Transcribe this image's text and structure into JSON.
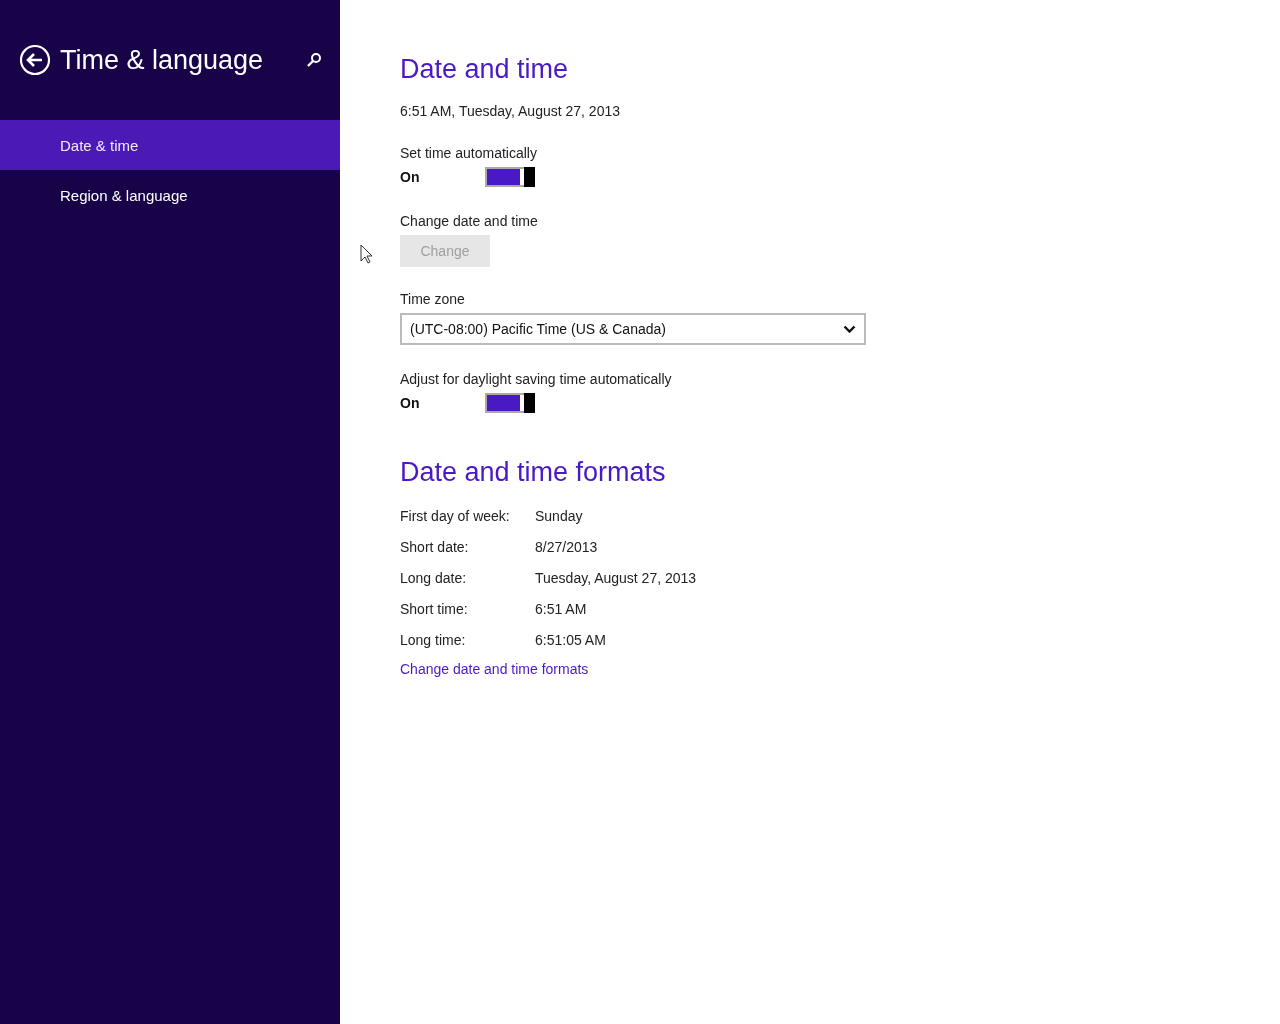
{
  "sidebar": {
    "title": "Time & language",
    "items": [
      {
        "label": "Date & time",
        "selected": true
      },
      {
        "label": "Region & language",
        "selected": false
      }
    ]
  },
  "date_and_time": {
    "heading": "Date and time",
    "current": "6:51 AM, Tuesday, August 27, 2013",
    "set_time_automatically": {
      "label": "Set time automatically",
      "state_text": "On",
      "on": true
    },
    "change_date_and_time": {
      "label": "Change date and time",
      "button": "Change",
      "disabled": true
    },
    "time_zone": {
      "label": "Time zone",
      "value": "(UTC-08:00) Pacific Time (US & Canada)"
    },
    "daylight_saving": {
      "label": "Adjust for daylight saving time automatically",
      "state_text": "On",
      "on": true
    }
  },
  "formats": {
    "heading": "Date and time formats",
    "rows": [
      {
        "label": "First day of week:",
        "value": "Sunday"
      },
      {
        "label": "Short date:",
        "value": "8/27/2013"
      },
      {
        "label": "Long date:",
        "value": "Tuesday, August 27, 2013"
      },
      {
        "label": "Short time:",
        "value": "6:51 AM"
      },
      {
        "label": "Long time:",
        "value": "6:51:05 AM"
      }
    ],
    "link": "Change date and time formats"
  }
}
